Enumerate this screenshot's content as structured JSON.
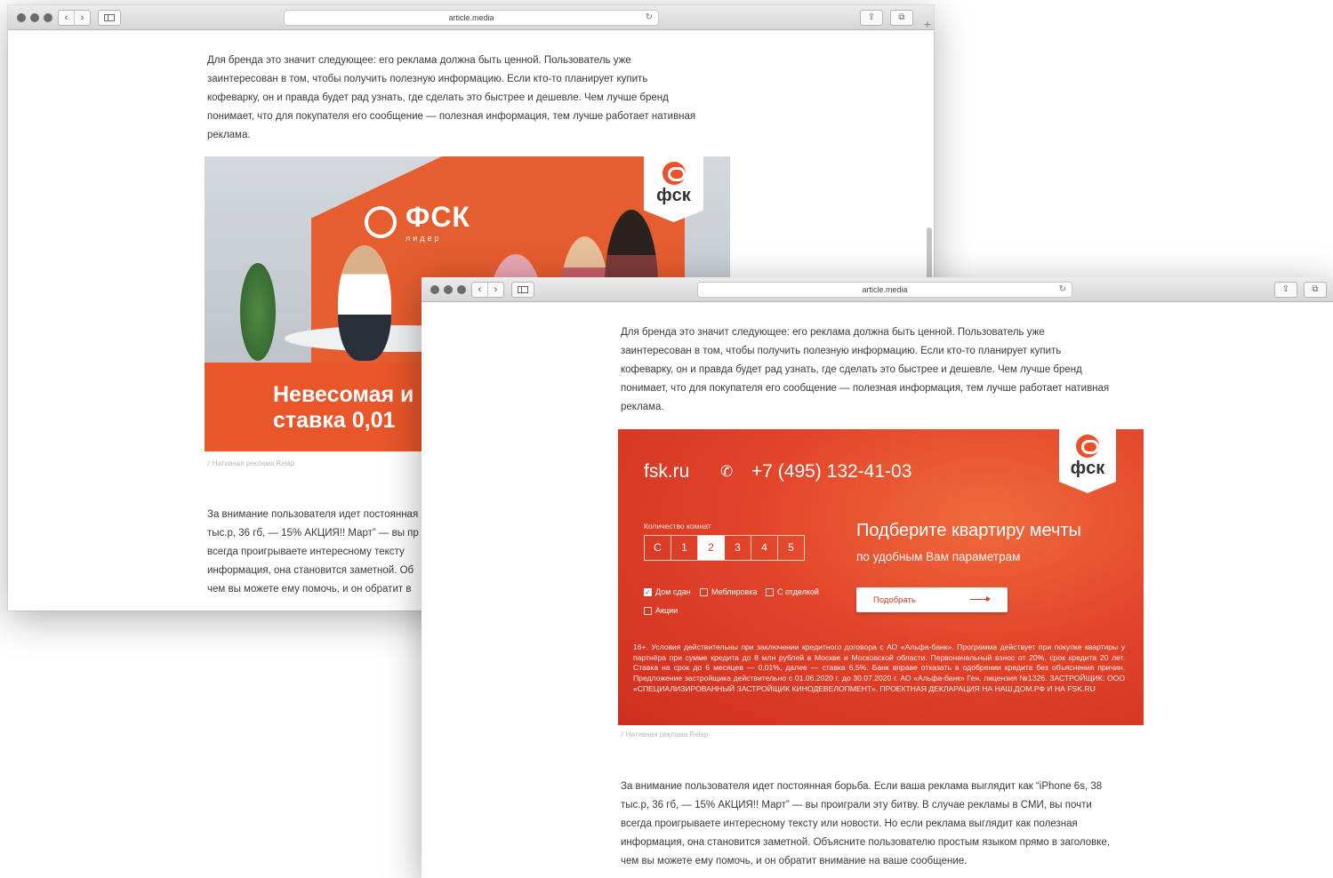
{
  "browser": {
    "url": "article.media"
  },
  "article": {
    "para1": "Для бренда это значит следующее: его реклама должна быть ценной. Пользователь уже заинтересован в том, чтобы получить полезную информацию. Если кто-то планирует купить кофеварку, он и правда будет рад узнать, где сделать это быстрее и дешевле. Чем лучше бренд понимает, что для покупателя его сообщение — полезная информация, тем лучше работает нативная реклама.",
    "para1_lines": [
      "Для бренда это значит следующее: его реклама должна быть ценной. Пользователь уже",
      "заинтересован в том, чтобы получить полезную информацию. Если кто-то планирует купить",
      "кофеварку, он и правда будет рад узнать, где сделать это быстрее и дешевле. Чем лучше бренд",
      "понимает, что для покупателя его сообщение — полезная информация, тем лучше работает нативная",
      "реклама."
    ],
    "caption": "Нативная реклама Relap",
    "para2_lines": [
      "За внимание пользователя идет постоянная борьба. Если ваша реклама выглядит как “iPhone 6s, 38",
      "тыс.р, 36 гб, — 15% АКЦИЯ!! Март” — вы проиграли эту битву. В случае рекламы в СМИ, вы почти",
      "всегда проигрываете интересному тексту или новости. Но если реклама выглядит как полезная",
      "информация, она становится заметной. Объясните пользователю простым языком прямо в заголовке,",
      "чем вы можете ему помочь, и он обратит внимание на ваше сообщение."
    ]
  },
  "window1": {
    "para2_lines_visible": [
      "За внимание пользователя идет постоянная",
      "тыс.р, 36 гб, — 15% АКЦИЯ!! Март” — вы пр",
      "всегда проигрываете интересному тексту",
      "информация, она становится заметной. Об",
      "чем вы можете ему помочь, и он обратит в"
    ],
    "banner": {
      "brand": "ФСК",
      "brand_sub": "лидер",
      "headline_lines": [
        "Невесомая и",
        "ставка 0,01"
      ],
      "flag_brand": "фск"
    }
  },
  "banner2": {
    "site": "fsk.ru",
    "phone": "+7 (495) 132-41-03",
    "flag_brand": "фск",
    "rooms_label": "Количество комнат",
    "rooms": [
      "С",
      "1",
      "2",
      "3",
      "4",
      "5"
    ],
    "rooms_selected": "2",
    "checkboxes": [
      {
        "label": "Дом сдан",
        "checked": true
      },
      {
        "label": "Меблировка",
        "checked": false
      },
      {
        "label": "С отделкой",
        "checked": false
      },
      {
        "label": "Акции",
        "checked": false
      }
    ],
    "headline": "Подберите квартиру мечты",
    "subheadline": "по удобным Вам параметрам",
    "button": "Подобрать",
    "legal": "16+. Условия действительны при заключении кредитного договора с АО «Альфа-банк». Программа действует при покупке квартиры у партнёра при сумме кредита до 8 млн рублей в Москве и Московской области. Первоначальный взнос от 20%, срок кредита 20 лет. Ставка на срок до 6 месяцев — 0,01%, далее — ставка 6,5%. Банк вправе отказать в одобрении кредита без объяснения причин. Предложение застройщика действительно с 01.06.2020 г. до 30.07.2020 г. АО «Альфа-банк» Ген. лицензия №1326. ЗАСТРОЙЩИК: ООО «СПЕЦИАЛИЗИРОВАННЫЙ ЗАСТРОЙЩИК КИНОДЕВЕЛОПМЕНТ». ПРОЕКТНАЯ ДЕКЛАРАЦИЯ НА НАШ.ДОМ.РФ И НА FSK.RU"
  },
  "colors": {
    "accent": "#e9512a",
    "banner_dark": "#cf2e1f"
  }
}
